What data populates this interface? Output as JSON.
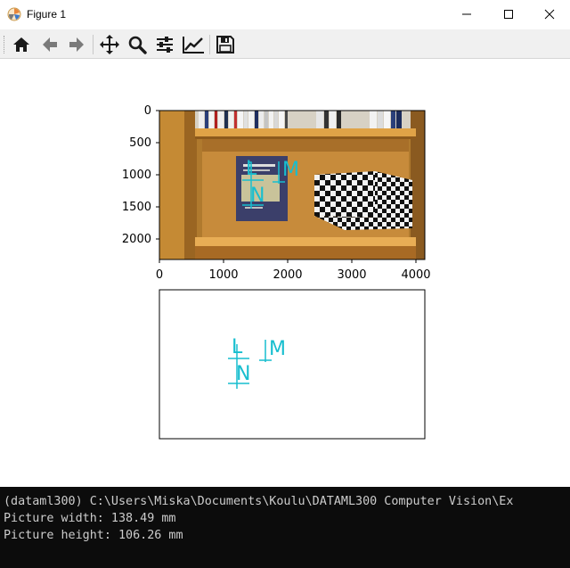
{
  "window": {
    "title": "Figure 1",
    "icon": "matplotlib-figure-icon",
    "controls": [
      "minimize-icon",
      "maximize-icon",
      "close-icon"
    ]
  },
  "toolbar": {
    "buttons": [
      {
        "name": "home-button",
        "icon": "home-icon",
        "tooltip": "Reset original view"
      },
      {
        "name": "back-button",
        "icon": "arrow-left-icon",
        "tooltip": "Back to previous view"
      },
      {
        "name": "forward-button",
        "icon": "arrow-right-icon",
        "tooltip": "Forward to next view"
      },
      {
        "name": "pan-button",
        "icon": "move-icon",
        "tooltip": "Pan axes"
      },
      {
        "name": "zoom-button",
        "icon": "magnifier-icon",
        "tooltip": "Zoom to rectangle"
      },
      {
        "name": "subplots-button",
        "icon": "sliders-icon",
        "tooltip": "Configure subplots"
      },
      {
        "name": "edit-axis-button",
        "icon": "line-chart-icon",
        "tooltip": "Edit axis"
      },
      {
        "name": "save-button",
        "icon": "floppy-disk-icon",
        "tooltip": "Save the figure"
      }
    ]
  },
  "figure": {
    "top_axes": {
      "x_ticks": [
        "0",
        "1000",
        "2000",
        "3000",
        "4000"
      ],
      "y_ticks": [
        "0",
        "500",
        "1000",
        "1500",
        "2000"
      ],
      "xlim": [
        0,
        4128
      ],
      "ylim": [
        2322,
        0
      ]
    },
    "annotations": {
      "labels": [
        "M",
        "N"
      ],
      "color": "#17becf"
    },
    "image_description": "bookshelf with book and checkerboard calibration pattern"
  },
  "console": {
    "lines": [
      "(dataml300) C:\\Users\\Miska\\Documents\\Koulu\\DATAML300 Computer Vision\\Ex",
      "Picture width: 138.49 mm",
      "Picture height: 106.26 mm"
    ],
    "background": "#0c0c0c",
    "text_color": "#cccccc"
  }
}
